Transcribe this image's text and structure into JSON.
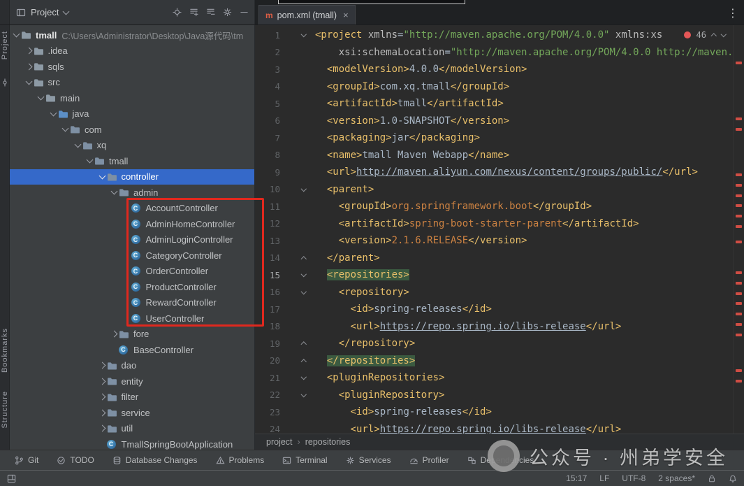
{
  "glyphs": {
    "maven": "m",
    "close": "×",
    "kebab": "⋮",
    "breadcrumb_sep": "›",
    "class_letter": "C"
  },
  "colors": {
    "selection_blue": "#3569c9",
    "error_red": "#cf4d44",
    "tag_gold": "#e8bf6a",
    "string_green": "#73a75a",
    "value_orange": "#cc8242",
    "highlight_green": "#3b5a40",
    "annotation_red": "#e0281e"
  },
  "left_rail": {
    "top": [
      "Project"
    ],
    "bottom": [
      "Bookmarks",
      "Structure"
    ]
  },
  "project_panel": {
    "header": {
      "title": "Project",
      "actions": [
        "locate",
        "expand-all",
        "collapse-all",
        "settings",
        "hide"
      ]
    },
    "tree": [
      {
        "depth": 0,
        "chevron": "down",
        "icon": "folder",
        "label": "tmall",
        "path": "C:\\Users\\Administrator\\Desktop\\Java源代码\\tm",
        "root": true
      },
      {
        "depth": 1,
        "chevron": "right",
        "icon": "folder",
        "label": ".idea"
      },
      {
        "depth": 1,
        "chevron": "right",
        "icon": "folder",
        "label": "sqls"
      },
      {
        "depth": 1,
        "chevron": "down",
        "icon": "folder",
        "label": "src"
      },
      {
        "depth": 2,
        "chevron": "down",
        "icon": "folder",
        "label": "main"
      },
      {
        "depth": 3,
        "chevron": "down",
        "icon": "folder-src",
        "label": "java"
      },
      {
        "depth": 4,
        "chevron": "down",
        "icon": "package",
        "label": "com"
      },
      {
        "depth": 5,
        "chevron": "down",
        "icon": "package",
        "label": "xq"
      },
      {
        "depth": 6,
        "chevron": "down",
        "icon": "package",
        "label": "tmall"
      },
      {
        "depth": 7,
        "chevron": "down",
        "icon": "package",
        "label": "controller",
        "selected": true
      },
      {
        "depth": 8,
        "chevron": "down",
        "icon": "package",
        "label": "admin"
      },
      {
        "depth": 9,
        "icon": "class",
        "label": "AccountController"
      },
      {
        "depth": 9,
        "icon": "class",
        "label": "AdminHomeController"
      },
      {
        "depth": 9,
        "icon": "class",
        "label": "AdminLoginController"
      },
      {
        "depth": 9,
        "icon": "class",
        "label": "CategoryController"
      },
      {
        "depth": 9,
        "icon": "class",
        "label": "OrderController"
      },
      {
        "depth": 9,
        "icon": "class",
        "label": "ProductController"
      },
      {
        "depth": 9,
        "icon": "class",
        "label": "RewardController"
      },
      {
        "depth": 9,
        "icon": "class",
        "label": "UserController"
      },
      {
        "depth": 8,
        "chevron": "right",
        "icon": "package",
        "label": "fore"
      },
      {
        "depth": 8,
        "icon": "class",
        "label": "BaseController"
      },
      {
        "depth": 7,
        "chevron": "right",
        "icon": "package",
        "label": "dao"
      },
      {
        "depth": 7,
        "chevron": "right",
        "icon": "package",
        "label": "entity"
      },
      {
        "depth": 7,
        "chevron": "right",
        "icon": "package",
        "label": "filter"
      },
      {
        "depth": 7,
        "chevron": "right",
        "icon": "package",
        "label": "service"
      },
      {
        "depth": 7,
        "chevron": "right",
        "icon": "package",
        "label": "util"
      },
      {
        "depth": 7,
        "icon": "class",
        "label": "TmallSpringBootApplication"
      }
    ]
  },
  "editor": {
    "tab": {
      "title": "pom.xml (tmall)"
    },
    "inspection": {
      "error_count": "46"
    },
    "current_line": 15,
    "breadcrumbs": [
      "project",
      "repositories"
    ],
    "error_stripe": [
      52,
      132,
      147,
      212,
      227,
      242,
      256,
      271,
      286,
      308,
      352,
      367,
      382,
      396,
      411,
      426,
      441,
      492,
      507
    ],
    "lines": [
      {
        "n": 1,
        "f": "d",
        "tk": [
          [
            "g",
            "<project "
          ],
          [
            "a",
            "xmlns"
          ],
          [
            "t",
            "="
          ],
          [
            "s",
            "\"http://maven.apache.org/POM/4.0.0\""
          ],
          [
            "t",
            " "
          ],
          [
            "a",
            "xmlns:xs"
          ]
        ]
      },
      {
        "n": 2,
        "tk": [
          [
            "t",
            "    "
          ],
          [
            "a",
            "xsi:schemaLocation"
          ],
          [
            "t",
            "="
          ],
          [
            "s",
            "\"http://maven.apache.org/POM/4.0.0 http://maven.a"
          ]
        ]
      },
      {
        "n": 3,
        "tk": [
          [
            "t",
            "  "
          ],
          [
            "g",
            "<modelVersion>"
          ],
          [
            "t",
            "4.0.0"
          ],
          [
            "g",
            "</modelVersion>"
          ]
        ]
      },
      {
        "n": 4,
        "tk": [
          [
            "t",
            "  "
          ],
          [
            "g",
            "<groupId>"
          ],
          [
            "t",
            "com.xq.tmall"
          ],
          [
            "g",
            "</groupId>"
          ]
        ]
      },
      {
        "n": 5,
        "tk": [
          [
            "t",
            "  "
          ],
          [
            "g",
            "<artifactId>"
          ],
          [
            "t",
            "tmall"
          ],
          [
            "g",
            "</artifactId>"
          ]
        ]
      },
      {
        "n": 6,
        "tk": [
          [
            "t",
            "  "
          ],
          [
            "g",
            "<version>"
          ],
          [
            "t",
            "1.0-SNAPSHOT"
          ],
          [
            "g",
            "</version>"
          ]
        ]
      },
      {
        "n": 7,
        "tk": [
          [
            "t",
            "  "
          ],
          [
            "g",
            "<packaging>"
          ],
          [
            "t",
            "jar"
          ],
          [
            "g",
            "</packaging>"
          ]
        ]
      },
      {
        "n": 8,
        "tk": [
          [
            "t",
            "  "
          ],
          [
            "g",
            "<name>"
          ],
          [
            "t",
            "tmall Maven Webapp"
          ],
          [
            "g",
            "</name>"
          ]
        ]
      },
      {
        "n": 9,
        "tk": [
          [
            "t",
            "  "
          ],
          [
            "g",
            "<url>"
          ],
          [
            "u",
            "http://maven.aliyun.com/nexus/content/groups/public/"
          ],
          [
            "g",
            "</url>"
          ]
        ]
      },
      {
        "n": 10,
        "f": "d",
        "tk": [
          [
            "t",
            "  "
          ],
          [
            "g",
            "<parent>"
          ]
        ]
      },
      {
        "n": 11,
        "tk": [
          [
            "t",
            "    "
          ],
          [
            "g",
            "<groupId>"
          ],
          [
            "o",
            "org.springframework.boot"
          ],
          [
            "g",
            "</groupId>"
          ]
        ]
      },
      {
        "n": 12,
        "tk": [
          [
            "t",
            "    "
          ],
          [
            "g",
            "<artifactId>"
          ],
          [
            "o",
            "spring-boot-starter-parent"
          ],
          [
            "g",
            "</artifactId>"
          ]
        ]
      },
      {
        "n": 13,
        "tk": [
          [
            "t",
            "    "
          ],
          [
            "g",
            "<version>"
          ],
          [
            "o",
            "2.1.6.RELEASE"
          ],
          [
            "g",
            "</version>"
          ]
        ]
      },
      {
        "n": 14,
        "f": "u",
        "tk": [
          [
            "t",
            "  "
          ],
          [
            "g",
            "</parent>"
          ]
        ]
      },
      {
        "n": 15,
        "f": "d",
        "tk": [
          [
            "t",
            "  "
          ],
          [
            "gh",
            "<repositories>"
          ]
        ]
      },
      {
        "n": 16,
        "f": "d",
        "tk": [
          [
            "t",
            "    "
          ],
          [
            "g",
            "<repository>"
          ]
        ]
      },
      {
        "n": 17,
        "tk": [
          [
            "t",
            "      "
          ],
          [
            "g",
            "<id>"
          ],
          [
            "t",
            "spring-releases"
          ],
          [
            "g",
            "</id>"
          ]
        ]
      },
      {
        "n": 18,
        "tk": [
          [
            "t",
            "      "
          ],
          [
            "g",
            "<url>"
          ],
          [
            "u",
            "https://repo.spring.io/libs-release"
          ],
          [
            "g",
            "</url>"
          ]
        ]
      },
      {
        "n": 19,
        "f": "u",
        "tk": [
          [
            "t",
            "    "
          ],
          [
            "g",
            "</repository>"
          ]
        ]
      },
      {
        "n": 20,
        "f": "u",
        "tk": [
          [
            "t",
            "  "
          ],
          [
            "gh",
            "</repositories>"
          ]
        ]
      },
      {
        "n": 21,
        "f": "d",
        "tk": [
          [
            "t",
            "  "
          ],
          [
            "g",
            "<pluginRepositories>"
          ]
        ]
      },
      {
        "n": 22,
        "f": "d",
        "tk": [
          [
            "t",
            "    "
          ],
          [
            "g",
            "<pluginRepository>"
          ]
        ]
      },
      {
        "n": 23,
        "tk": [
          [
            "t",
            "      "
          ],
          [
            "g",
            "<id>"
          ],
          [
            "t",
            "spring-releases"
          ],
          [
            "g",
            "</id>"
          ]
        ]
      },
      {
        "n": 24,
        "tk": [
          [
            "t",
            "      "
          ],
          [
            "g",
            "<url>"
          ],
          [
            "u",
            "https://repo.spring.io/libs-release"
          ],
          [
            "g",
            "</url>"
          ]
        ]
      }
    ]
  },
  "bottom_bar": {
    "items": [
      {
        "icon": "git",
        "label": "Git"
      },
      {
        "icon": "todo",
        "label": "TODO"
      },
      {
        "icon": "database",
        "label": "Database Changes"
      },
      {
        "icon": "problems",
        "label": "Problems"
      },
      {
        "icon": "terminal",
        "label": "Terminal"
      },
      {
        "icon": "services",
        "label": "Services"
      },
      {
        "icon": "profiler",
        "label": "Profiler"
      },
      {
        "icon": "dependencies",
        "label": "Dependencies"
      }
    ]
  },
  "status_bar": {
    "items": [
      {
        "name": "caret-position",
        "label": "15:17"
      },
      {
        "name": "line-separator",
        "label": "LF"
      },
      {
        "name": "encoding",
        "label": "UTF-8"
      },
      {
        "name": "indent",
        "label": "2 spaces*"
      }
    ]
  },
  "watermark": {
    "text": "公众号 · 州弟学安全"
  }
}
